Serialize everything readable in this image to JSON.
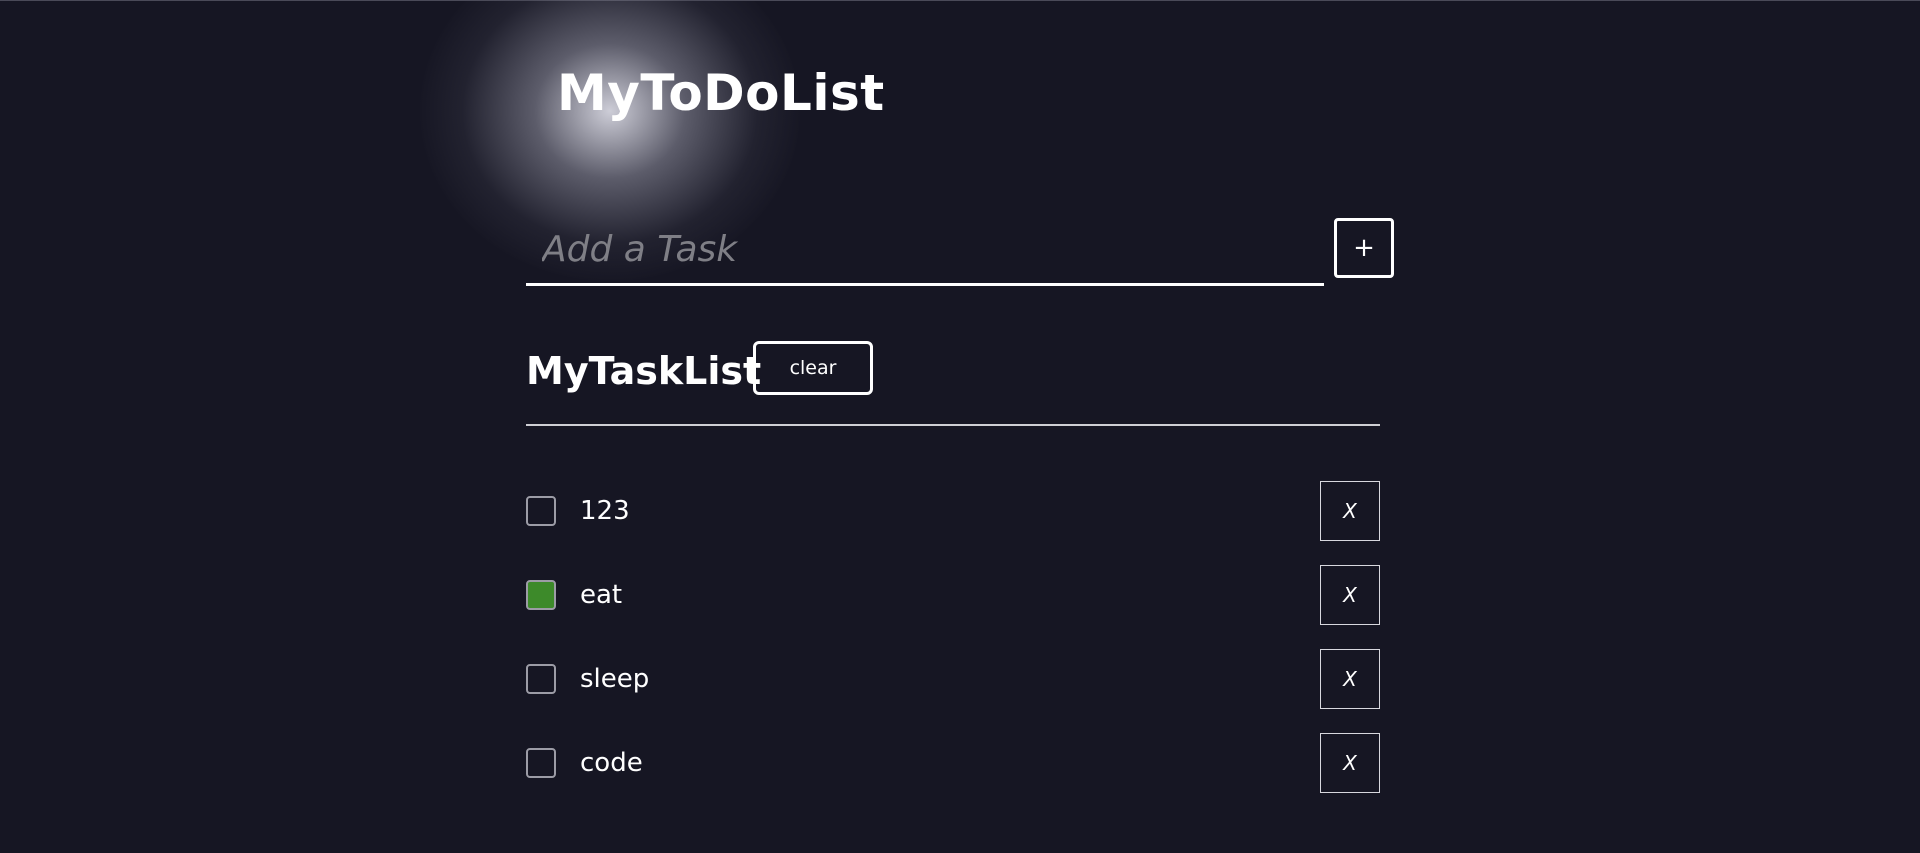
{
  "app": {
    "title": "MyToDoList"
  },
  "add_task": {
    "placeholder": "Add a Task",
    "value": "",
    "add_label": "+"
  },
  "task_list": {
    "title": "MyTaskList",
    "clear_label": "clear",
    "items": [
      {
        "label": "123",
        "checked": false,
        "delete_label": "X"
      },
      {
        "label": "eat",
        "checked": true,
        "delete_label": "X"
      },
      {
        "label": "sleep",
        "checked": false,
        "delete_label": "X"
      },
      {
        "label": "code",
        "checked": false,
        "delete_label": "X"
      }
    ]
  },
  "colors": {
    "background": "#161623",
    "checked": "#3d8a2a",
    "text": "#ffffff",
    "placeholder": "#7f7f86"
  }
}
